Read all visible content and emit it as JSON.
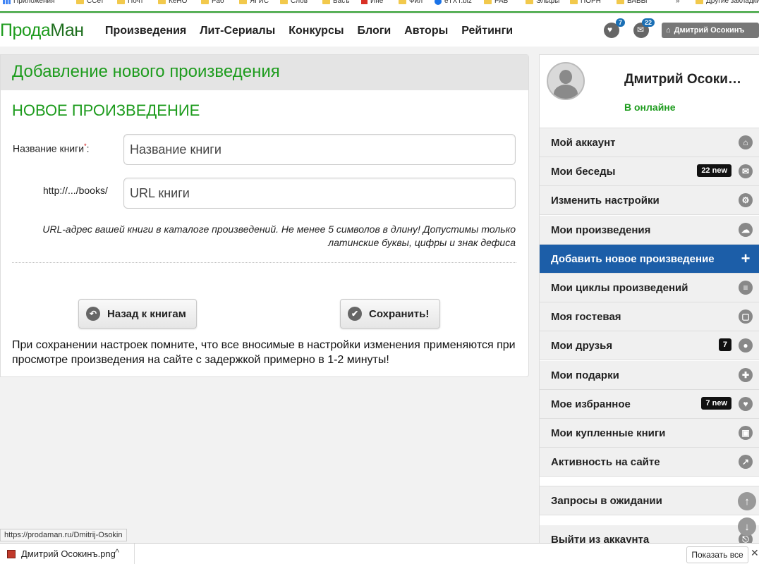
{
  "browser": {
    "bookmarks": [
      {
        "label": "Приложения",
        "icon": "apps-icon"
      },
      {
        "label": "ССет",
        "icon": "folder-icon"
      },
      {
        "label": "Почт",
        "icon": "folder-icon"
      },
      {
        "label": "КеНО",
        "icon": "folder-icon"
      },
      {
        "label": "Раб",
        "icon": "folder-icon"
      },
      {
        "label": "ЯГИС",
        "icon": "folder-icon"
      },
      {
        "label": "Слов",
        "icon": "folder-icon"
      },
      {
        "label": "Васъ",
        "icon": "folder-icon"
      },
      {
        "label": "Ине",
        "icon": "red-square-icon"
      },
      {
        "label": "Фил",
        "icon": "folder-icon"
      },
      {
        "label": "eTXT.biz",
        "icon": "etxt-icon"
      },
      {
        "label": "РАБ",
        "icon": "folder-icon"
      },
      {
        "label": "Эльфы",
        "icon": "folder-icon"
      },
      {
        "label": "ПОРН",
        "icon": "folder-icon"
      },
      {
        "label": "БАБЫ",
        "icon": "folder-icon"
      }
    ],
    "more": "»",
    "other_bookmarks": "Другие закладки",
    "status_url": "https://prodaman.ru/Dmitrij-Osokin",
    "download": {
      "filename": "Дмитрий Осокинъ.png",
      "chevron": "^",
      "show_all": "Показать все",
      "close": "✕"
    }
  },
  "header": {
    "logo_part1": "Прода",
    "logo_part2": "Ман",
    "nav": [
      "Произведения",
      "Лит-Сериалы",
      "Конкурсы",
      "Блоги",
      "Авторы",
      "Рейтинги"
    ],
    "favorites_badge": "7",
    "messages_badge": "22",
    "user_button": "Дмитрий Осокинъ",
    "colors": {
      "accent_green": "#1e9c1e",
      "active_blue": "#1c5ea8",
      "badge_blue": "#1a6fb5"
    }
  },
  "form": {
    "page_title": "Добавление нового произведения",
    "section_title": "НОВОЕ ПРОИЗВЕДЕНИЕ",
    "title_label": "Название книги",
    "required_mark": "*",
    "title_label_colon": ":",
    "title_placeholder": "Название книги",
    "url_prefix": "http://.../books/",
    "url_placeholder": "URL книги",
    "url_hint": "URL-адрес вашей книги в каталоге произведений. Не менее 5 символов в длину! Допустимы только латинские буквы, цифры и знак дефиса",
    "back_button": "Назад к книгам",
    "save_button": "Сохранить!",
    "notice": "При сохранении настроек помните, что все вносимые в настройки изменения применяются при просмотре произведения на сайте с задержкой примерно в 1-2 минуты!"
  },
  "sidebar": {
    "name": "Дмитрий Осоки…",
    "status": "В онлайне",
    "items": [
      {
        "label": "Мой аккаунт",
        "icon": "home-icon",
        "glyph": "⌂",
        "badge": ""
      },
      {
        "label": "Мои беседы",
        "icon": "envelope-icon",
        "glyph": "✉",
        "badge": "22 new"
      },
      {
        "label": "Изменить настройки",
        "icon": "gear-icon",
        "glyph": "⚙",
        "badge": ""
      },
      {
        "label": "Мои произведения",
        "icon": "cloud-icon",
        "glyph": "☁",
        "badge": ""
      },
      {
        "label": "Добавить новое произведение",
        "icon": "plus-icon",
        "glyph": "+",
        "badge": "",
        "active": true
      },
      {
        "label": "Мои циклы произведений",
        "icon": "list-icon",
        "glyph": "≡",
        "badge": ""
      },
      {
        "label": "Моя гостевая",
        "icon": "chat-icon",
        "glyph": "▢",
        "badge": ""
      },
      {
        "label": "Мои друзья",
        "icon": "user-icon",
        "glyph": "●",
        "badge": "7"
      },
      {
        "label": "Мои подарки",
        "icon": "gift-icon",
        "glyph": "✚",
        "badge": ""
      },
      {
        "label": "Мое избранное",
        "icon": "heart-icon",
        "glyph": "♥",
        "badge": "7 new"
      },
      {
        "label": "Мои купленные книги",
        "icon": "bag-icon",
        "glyph": "▣",
        "badge": ""
      },
      {
        "label": "Активность на сайте",
        "icon": "share-icon",
        "glyph": "↗",
        "badge": ""
      }
    ],
    "extra_items": [
      {
        "label": "Запросы в ожидании",
        "icon": "clock-icon",
        "glyph": "◷"
      },
      {
        "label": "Выйти из аккаунта",
        "icon": "logout-icon",
        "glyph": "⎋"
      }
    ]
  },
  "scroll": {
    "up": "↑",
    "down": "↓"
  }
}
